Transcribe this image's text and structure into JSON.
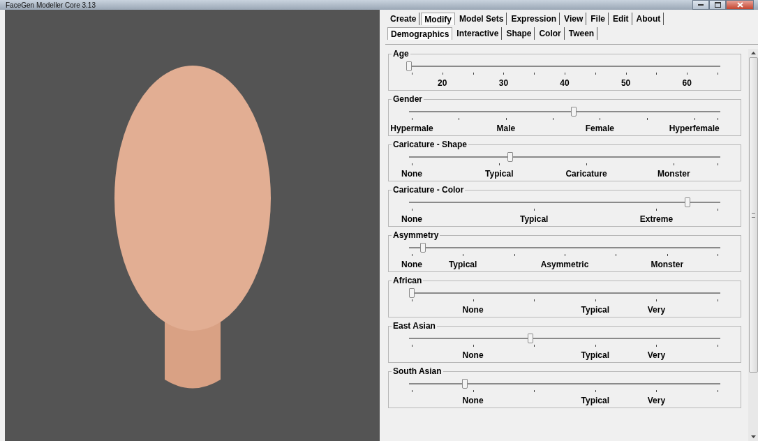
{
  "window": {
    "title": "FaceGen Modeller Core 3.13"
  },
  "main_tabs": [
    {
      "label": "Create",
      "selected": false
    },
    {
      "label": "Modify",
      "selected": true
    },
    {
      "label": "Model Sets",
      "selected": false
    },
    {
      "label": "Expression",
      "selected": false
    },
    {
      "label": "View",
      "selected": false
    },
    {
      "label": "File",
      "selected": false
    },
    {
      "label": "Edit",
      "selected": false
    },
    {
      "label": "About",
      "selected": false
    }
  ],
  "sub_tabs": [
    {
      "label": "Demographics",
      "selected": true
    },
    {
      "label": "Interactive",
      "selected": false
    },
    {
      "label": "Shape",
      "selected": false
    },
    {
      "label": "Color",
      "selected": false
    },
    {
      "label": "Tween",
      "selected": false
    }
  ],
  "sliders": [
    {
      "title": "Age",
      "level": 0.0,
      "labels": [
        "20",
        "30",
        "40",
        "50",
        "60"
      ]
    },
    {
      "title": "Gender",
      "level": 0.53,
      "labels": [
        "Hypermale",
        "Male",
        "Female",
        "Hyperfemale"
      ]
    },
    {
      "title": "Caricature - Shape",
      "level": 0.325,
      "labels": [
        "None",
        "Typical",
        "Caricature",
        "Monster"
      ]
    },
    {
      "title": "Caricature - Color",
      "level": 0.895,
      "labels": [
        "None",
        "Typical",
        "Extreme"
      ]
    },
    {
      "title": "Asymmetry",
      "level": 0.045,
      "labels": [
        "None",
        "Typical",
        "Asymmetric",
        "Monster"
      ]
    },
    {
      "title": "African",
      "level": 0.01,
      "labels": [
        "None",
        "Typical",
        "Very"
      ]
    },
    {
      "title": "East Asian",
      "level": 0.39,
      "labels": [
        "None",
        "Typical",
        "Very"
      ]
    },
    {
      "title": "South Asian",
      "level": 0.18,
      "labels": [
        "None",
        "Typical",
        "Very"
      ]
    }
  ]
}
